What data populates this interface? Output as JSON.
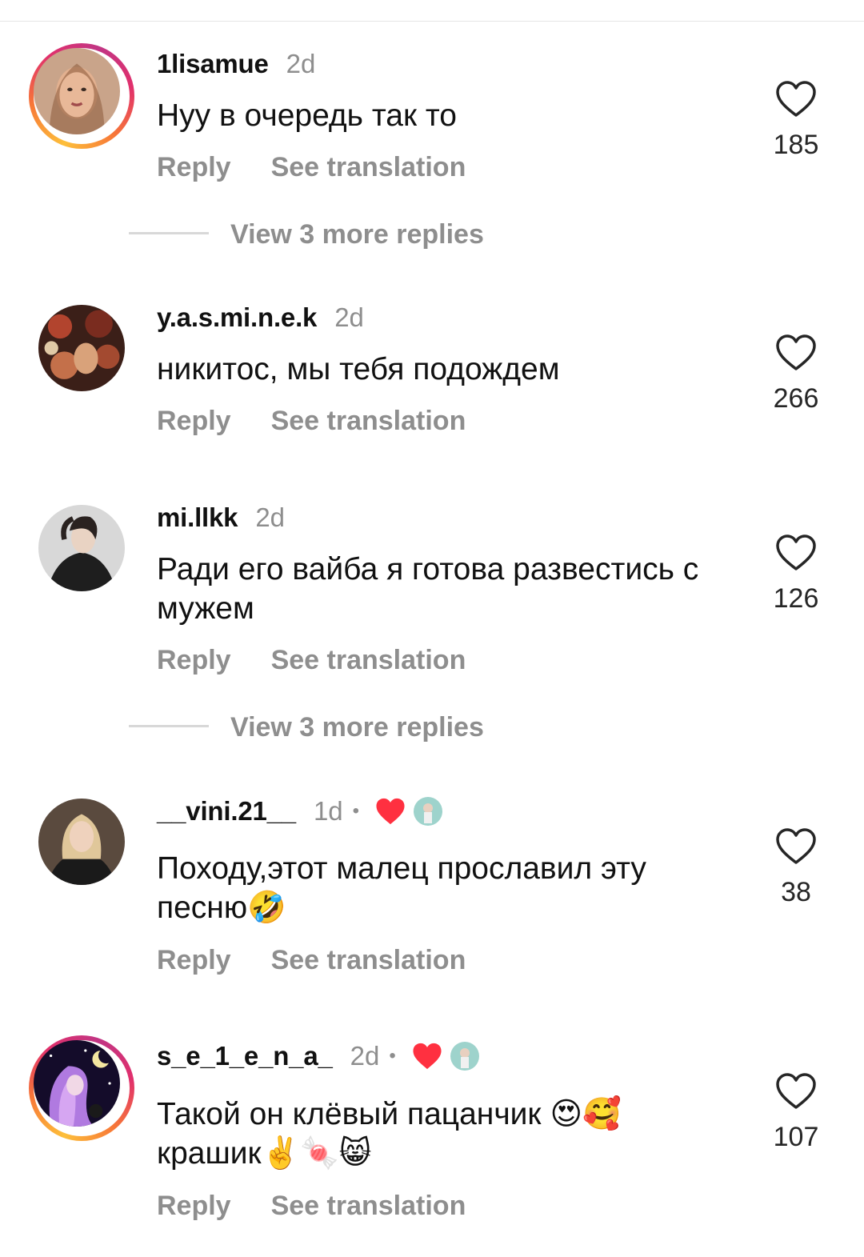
{
  "comments": [
    {
      "username": "1lisamue",
      "time": "2d",
      "text": "Нуу в очередь так то",
      "reply_label": "Reply",
      "translate_label": "See translation",
      "likes": "185"
    },
    {
      "username": "y.a.s.mi.n.e.k",
      "time": "2d",
      "text": "никитос, мы тебя подождем",
      "reply_label": "Reply",
      "translate_label": "See translation",
      "likes": "266"
    },
    {
      "username": "mi.llkk",
      "time": "2d",
      "text": "Ради его вайба я готова развестись с мужем",
      "reply_label": "Reply",
      "translate_label": "See translation",
      "likes": "126"
    },
    {
      "username": "__vini.21__",
      "time": "1d",
      "dot": "•",
      "text": "Походу,этот малец прославил эту песню🤣",
      "reply_label": "Reply",
      "translate_label": "See translation",
      "likes": "38"
    },
    {
      "username": "s_e_1_e_n_a_",
      "time": "2d",
      "dot": "•",
      "text": "Такой он клёвый пацанчик 😍🥰 крашик✌️🍬😸",
      "reply_label": "Reply",
      "translate_label": "See translation",
      "likes": "107"
    }
  ],
  "view_more_replies": [
    "View 3 more replies",
    "View 3 more replies"
  ],
  "colors": {
    "secondary_text": "#8e8e8e",
    "liked_heart": "#ff3040",
    "story_ring": [
      "#fdbf3a",
      "#f77737",
      "#e1306c",
      "#c13584"
    ]
  },
  "icons": {
    "like": "heart-outline-icon",
    "creator_liked": "heart-filled-icon"
  }
}
